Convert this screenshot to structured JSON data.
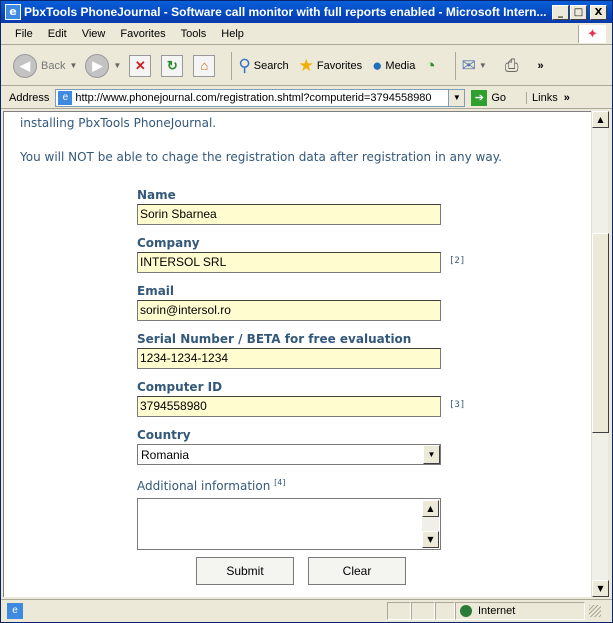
{
  "window": {
    "title": "PbxTools PhoneJournal - Software call monitor with full reports enabled - Microsoft Intern...",
    "min": "_",
    "max": "□",
    "close": "X"
  },
  "menu": [
    "File",
    "Edit",
    "View",
    "Favorites",
    "Tools",
    "Help"
  ],
  "toolbar": {
    "back": "Back",
    "search": "Search",
    "favorites": "Favorites",
    "media": "Media"
  },
  "address": {
    "label": "Address",
    "url": "http://www.phonejournal.com/registration.shtml?computerid=3794558980",
    "go": "Go",
    "links": "Links"
  },
  "page": {
    "intro_line": "installing PbxTools PhoneJournal.",
    "warning": "You will NOT be able to chage the registration data after registration in any way."
  },
  "form": {
    "name_label": "Name",
    "name_value": "Sorin Sbarnea",
    "company_label": "Company",
    "company_value": "INTERSOL SRL",
    "company_note": "[2]",
    "email_label": "Email",
    "email_value": "sorin@intersol.ro",
    "serial_label": "Serial Number / BETA for free evaluation",
    "serial_value": "1234-1234-1234",
    "computer_label": "Computer ID",
    "computer_value": "3794558980",
    "computer_note": "[3]",
    "country_label": "Country",
    "country_value": "Romania",
    "additional_label": "Additional information",
    "additional_note": "[4]",
    "submit": "Submit",
    "clear": "Clear"
  },
  "status": {
    "zone": "Internet"
  }
}
